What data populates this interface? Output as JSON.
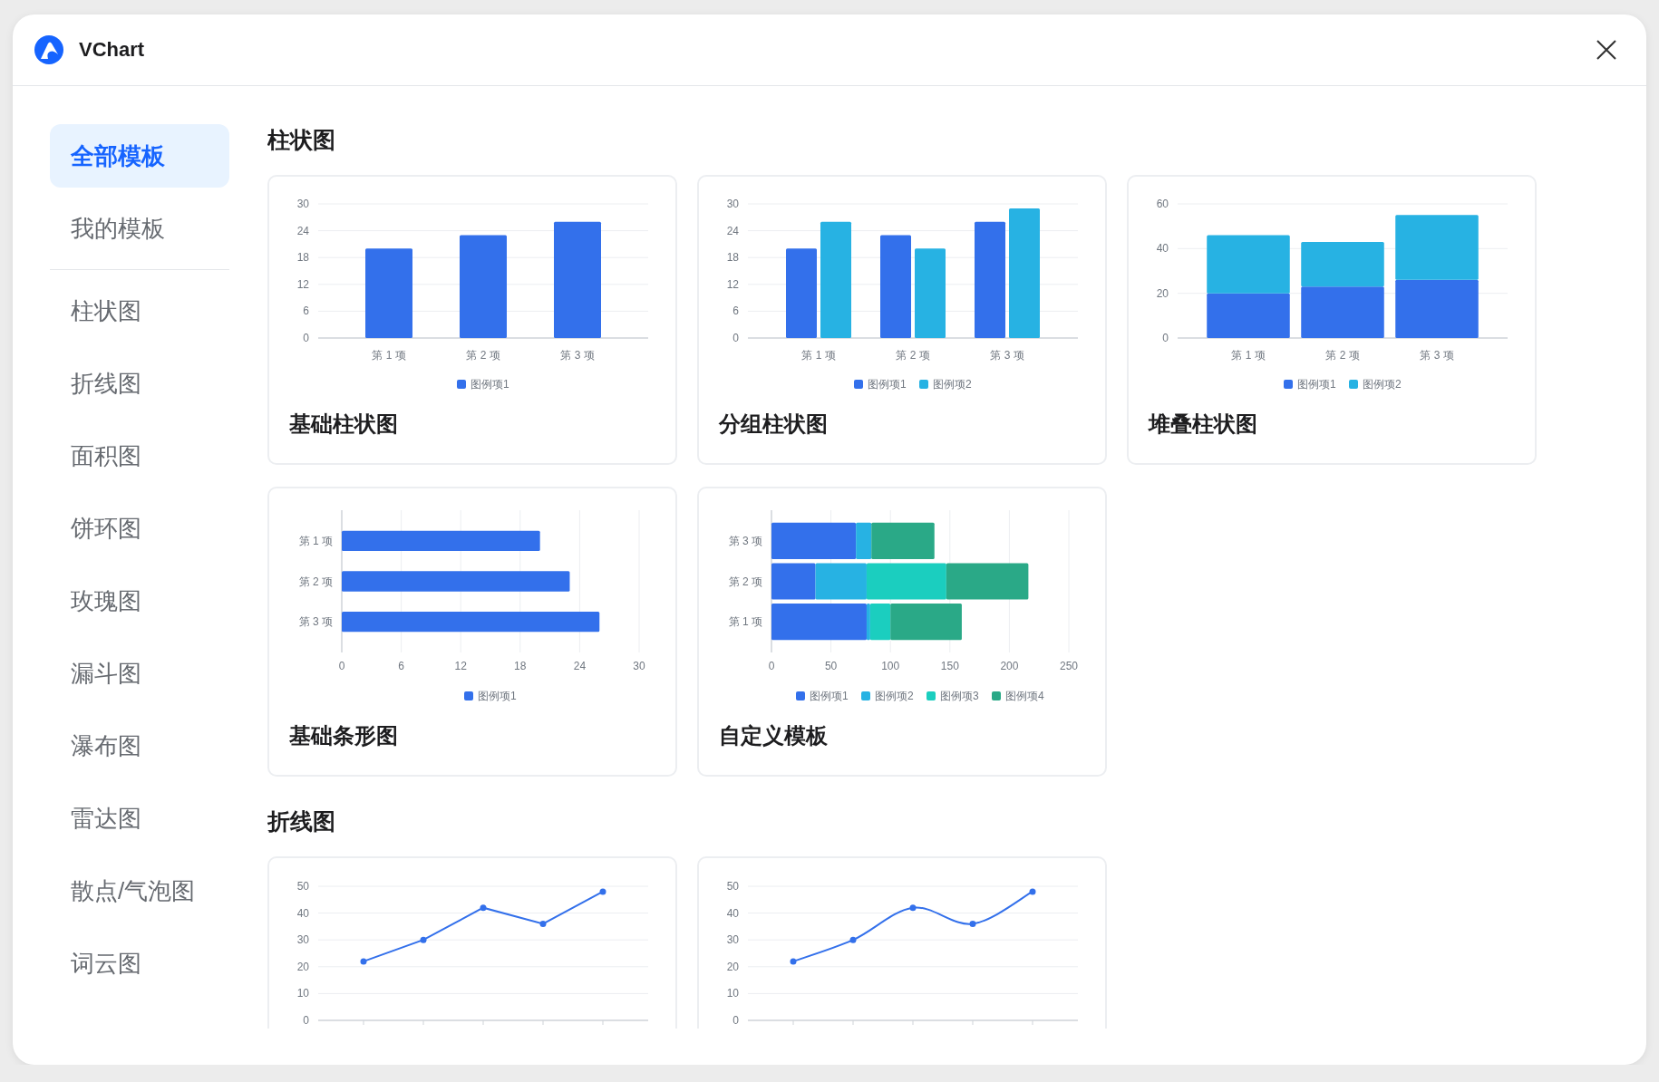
{
  "window": {
    "title": "VChart"
  },
  "sidebar": {
    "templates": [
      {
        "label": "全部模板",
        "selected": true
      },
      {
        "label": "我的模板",
        "selected": false
      }
    ],
    "categories": [
      {
        "label": "柱状图",
        "selected": false
      },
      {
        "label": "折线图",
        "selected": false
      },
      {
        "label": "面积图",
        "selected": false
      },
      {
        "label": "饼环图",
        "selected": false
      },
      {
        "label": "玫瑰图",
        "selected": false
      },
      {
        "label": "漏斗图",
        "selected": false
      },
      {
        "label": "瀑布图",
        "selected": false
      },
      {
        "label": "雷达图",
        "selected": false
      },
      {
        "label": "散点/气泡图",
        "selected": false
      },
      {
        "label": "词云图",
        "selected": false
      }
    ]
  },
  "sections": [
    {
      "title": "柱状图",
      "cards": [
        {
          "title": "基础柱状图",
          "chart_data": {
            "type": "bar",
            "grid": true,
            "legend": true,
            "categories": [
              "第 1 项",
              "第 2 项",
              "第 3 项"
            ],
            "ylim": [
              0,
              30
            ],
            "yticks": [
              0,
              6,
              12,
              18,
              24,
              30
            ],
            "series": [
              {
                "name": "图例项1",
                "color": "#3370eb",
                "values": [
                  20,
                  23,
                  26
                ]
              }
            ]
          }
        },
        {
          "title": "分组柱状图",
          "chart_data": {
            "type": "bar",
            "grid": true,
            "legend": true,
            "categories": [
              "第 1 项",
              "第 2 项",
              "第 3 项"
            ],
            "ylim": [
              0,
              30
            ],
            "yticks": [
              0,
              6,
              12,
              18,
              24,
              30
            ],
            "series": [
              {
                "name": "图例项1",
                "color": "#3370eb",
                "values": [
                  20,
                  23,
                  26
                ]
              },
              {
                "name": "图例项2",
                "color": "#27b2e3",
                "values": [
                  26,
                  20,
                  29
                ]
              }
            ]
          }
        },
        {
          "title": "堆叠柱状图",
          "chart_data": {
            "type": "bar",
            "grid": true,
            "legend": true,
            "stacked": true,
            "categories": [
              "第 1 项",
              "第 2 项",
              "第 3 项"
            ],
            "ylim": [
              0,
              60
            ],
            "yticks": [
              0,
              20,
              40,
              60
            ],
            "series": [
              {
                "name": "图例项1",
                "color": "#3370eb",
                "values": [
                  20,
                  23,
                  26
                ]
              },
              {
                "name": "图例项2",
                "color": "#27b2e3",
                "values": [
                  26,
                  20,
                  29
                ]
              }
            ]
          }
        },
        {
          "title": "基础条形图",
          "chart_data": {
            "type": "bar",
            "grid": true,
            "legend": true,
            "orientation": "horizontal",
            "categories": [
              "第 1 项",
              "第 2 项",
              "第 3 项"
            ],
            "xlim": [
              0,
              30
            ],
            "xticks": [
              0,
              6,
              12,
              18,
              24,
              30
            ],
            "series": [
              {
                "name": "图例项1",
                "color": "#3370eb",
                "values": [
                  20,
                  23,
                  26
                ]
              }
            ]
          }
        },
        {
          "title": "自定义模板",
          "chart_data": {
            "type": "bar",
            "grid": true,
            "legend": true,
            "orientation": "horizontal",
            "stacked": true,
            "categories": [
              "第 3 项",
              "第 2 项",
              "第 1 项"
            ],
            "xlim": [
              0,
              250
            ],
            "xticks": [
              0,
              50,
              100,
              150,
              200,
              250
            ],
            "series": [
              {
                "name": "图例项1",
                "color": "#3370eb",
                "values": [
                  71,
                  37,
                  80
                ]
              },
              {
                "name": "图例项2",
                "color": "#27b2e3",
                "values": [
                  13,
                  43,
                  3
                ]
              },
              {
                "name": "图例项3",
                "color": "#1bcebf",
                "values": [
                  0,
                  67,
                  17
                ]
              },
              {
                "name": "图例项4",
                "color": "#2aa987",
                "values": [
                  53,
                  69,
                  60
                ]
              }
            ]
          }
        }
      ]
    },
    {
      "title": "折线图",
      "cards": [
        {
          "smooth": false,
          "chart_data": {
            "type": "line",
            "grid": true,
            "ylim": [
              0,
              50
            ],
            "yticks": [
              0,
              10,
              20,
              30,
              40,
              50
            ],
            "series": [
              {
                "color": "#3370eb",
                "marker": true,
                "values": [
                  22,
                  30,
                  42,
                  36,
                  48
                ]
              }
            ]
          }
        },
        {
          "smooth": true,
          "chart_data": {
            "type": "line",
            "grid": true,
            "ylim": [
              0,
              50
            ],
            "yticks": [
              0,
              10,
              20,
              30,
              40,
              50
            ],
            "series": [
              {
                "color": "#3370eb",
                "marker": true,
                "values": [
                  22,
                  30,
                  42,
                  36,
                  48
                ]
              }
            ]
          }
        }
      ]
    }
  ]
}
